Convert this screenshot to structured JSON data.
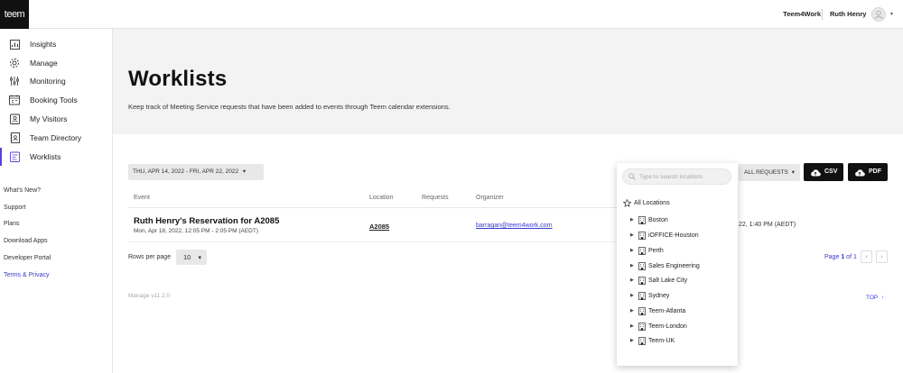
{
  "app": {
    "logo_text": "teem"
  },
  "header": {
    "org_name": "Teem4Work",
    "user_name": "Ruth Henry",
    "user_menu_caret": "▾"
  },
  "sidebar": {
    "nav": [
      {
        "label": "Insights",
        "icon": "insights-icon"
      },
      {
        "label": "Manage",
        "icon": "gear-icon"
      },
      {
        "label": "Monitoring",
        "icon": "sliders-icon"
      },
      {
        "label": "Booking Tools",
        "icon": "calendar-icon"
      },
      {
        "label": "My Visitors",
        "icon": "visitor-badge-icon"
      },
      {
        "label": "Team Directory",
        "icon": "directory-icon"
      },
      {
        "label": "Worklists",
        "icon": "worklist-icon",
        "active": true
      }
    ],
    "links": [
      "What's New?",
      "Support",
      "Plans",
      "Download Apps",
      "Developer Portal",
      "Terms & Privacy"
    ]
  },
  "page": {
    "title": "Worklists",
    "description": "Keep track of Meeting Service requests that have been added to events through Teem calendar extensions."
  },
  "toolbar": {
    "date_range": "THU, APR 14, 2022 - FRI, APR 22, 2022",
    "filter_label": "ALL REQUESTS",
    "csv_label": "CSV",
    "pdf_label": "PDF"
  },
  "table": {
    "columns": [
      "Event",
      "Location",
      "Requests",
      "Organizer"
    ],
    "rows": [
      {
        "event_title": "Ruth Henry's Reservation for A2085",
        "event_time": "Mon, Apr 18, 2022, 12:05 PM - 2:05 PM (AEDT)",
        "location": "A2085",
        "organizer": "barragan@teem4work.com",
        "created_partial": "22, 1:40 PM (AEDT)"
      }
    ]
  },
  "pagination": {
    "rows_per_page_label": "Rows per page",
    "rows_per_page_value": "10",
    "page_prefix": "Page",
    "page_current": "1",
    "page_suffix": "of 1",
    "prev": "‹",
    "next": "›"
  },
  "footer": {
    "version": "Manage v11.2.0",
    "top_link": "TOP"
  },
  "location_dropdown": {
    "search_placeholder": "Type to search locations",
    "all_label": "All Locations",
    "locations": [
      "Boston",
      "iOFFICE-Houston",
      "Perth",
      "Sales Engineering",
      "Salt Lake City",
      "Sydney",
      "Teem-Atlanta",
      "Teem-London",
      "Teem-UK"
    ]
  },
  "colors": {
    "accent": "#5b3fd6",
    "link": "#3a3ad0",
    "dark_button": "#111111",
    "hero_bg": "#f3f3f3"
  }
}
